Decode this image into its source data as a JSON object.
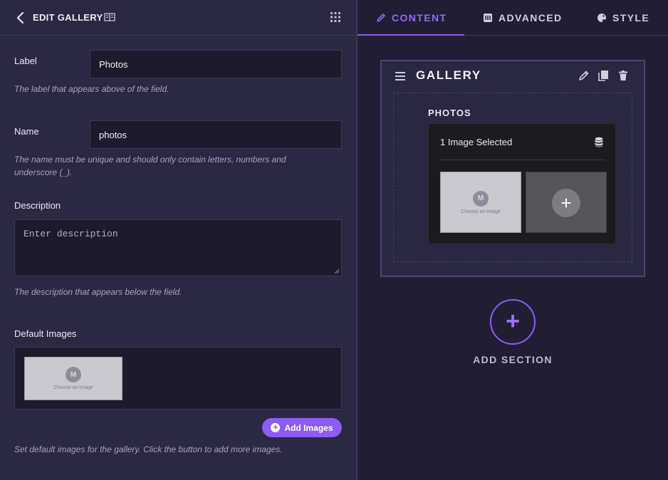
{
  "editor": {
    "title": "EDIT GALLERY",
    "back_icon": "chevron-left-icon",
    "docs_icon": "book-icon",
    "menu_icon": "grid-icon"
  },
  "fields": {
    "label": {
      "label": "Label",
      "value": "Photos",
      "help": "The label that appears above of the field."
    },
    "name": {
      "label": "Name",
      "value": "photos",
      "help": "The name must be unique and should only contain letters, numbers and underscore (_)."
    },
    "description": {
      "label": "Description",
      "placeholder": "Enter description",
      "help": "The description that appears below the field."
    },
    "default_images": {
      "label": "Default Images",
      "image_caption": "Choose an Image",
      "add_button": "Add Images",
      "help": "Set default images for the gallery. Click the button to add more images."
    }
  },
  "tabs": [
    {
      "label": "CONTENT",
      "icon": "pencil-icon",
      "active": true
    },
    {
      "label": "ADVANCED",
      "icon": "advanced-icon",
      "active": false
    },
    {
      "label": "STYLE",
      "icon": "palette-icon",
      "active": false
    }
  ],
  "gallery_card": {
    "title": "GALLERY",
    "field_label": "PHOTOS",
    "selected_text": "1 Image Selected",
    "image_caption": "Choose an Image",
    "add_tile_symbol": "+"
  },
  "add_section": {
    "symbol": "+",
    "label": "ADD SECTION"
  },
  "colors": {
    "accent": "#8b5cf6",
    "panel": "#2b2842",
    "canvas": "#211e33"
  }
}
